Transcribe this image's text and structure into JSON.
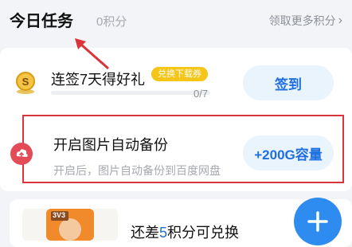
{
  "header": {
    "title": "今日任务",
    "points": "0积分",
    "more_label": "领取更多积分",
    "chevron": "›"
  },
  "task_checkin": {
    "icon": "gold-coin-s-icon",
    "title": "连签7天得好礼",
    "badge": "兑换下载券",
    "progress_text": "0/7",
    "progress_fraction": 0,
    "button_label": "签到"
  },
  "task_backup": {
    "icon": "cloud-upload-icon",
    "title": "开启图片自动备份",
    "description": "开启后，图片自动备份到百度网盘",
    "button_label": "+200G容量"
  },
  "redeem": {
    "prefix": "还差",
    "number": "5",
    "suffix": "积分可兑换",
    "thumbnail_label": "3V3"
  },
  "colors": {
    "accent_blue": "#1f6fe0",
    "button_bg": "#eaf4fc",
    "badge_yellow": "#f5c518",
    "highlight_red": "#d9353a",
    "fab_blue": "#2e8cf0"
  },
  "fab": {
    "icon": "plus-icon"
  }
}
